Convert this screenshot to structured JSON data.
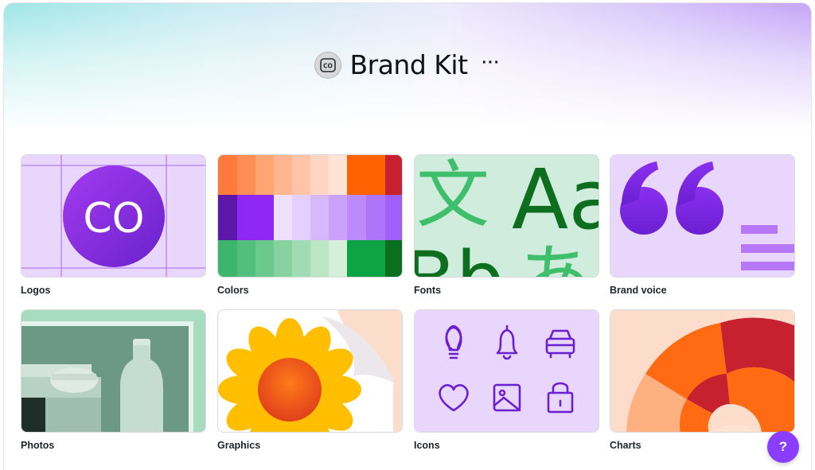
{
  "header": {
    "title": "Brand Kit",
    "avatar_initials": "CO",
    "more_label": "···"
  },
  "cards": [
    {
      "label": "Logos",
      "logo_text": "CO"
    },
    {
      "label": "Colors"
    },
    {
      "label": "Fonts",
      "glyphs": [
        "文",
        "Aa",
        "Bb",
        "あ"
      ]
    },
    {
      "label": "Brand voice"
    },
    {
      "label": "Photos"
    },
    {
      "label": "Graphics"
    },
    {
      "label": "Icons",
      "icons": [
        "lightbulb-icon",
        "bell-icon",
        "car-icon",
        "heart-icon",
        "image-icon",
        "lock-icon"
      ]
    },
    {
      "label": "Charts"
    }
  ],
  "help": {
    "label": "?"
  },
  "colors": {
    "accent": "#8b3dff",
    "lavender": "#e8d6fc",
    "mint": "#d0ecdc",
    "peach": "#fcdcca"
  }
}
